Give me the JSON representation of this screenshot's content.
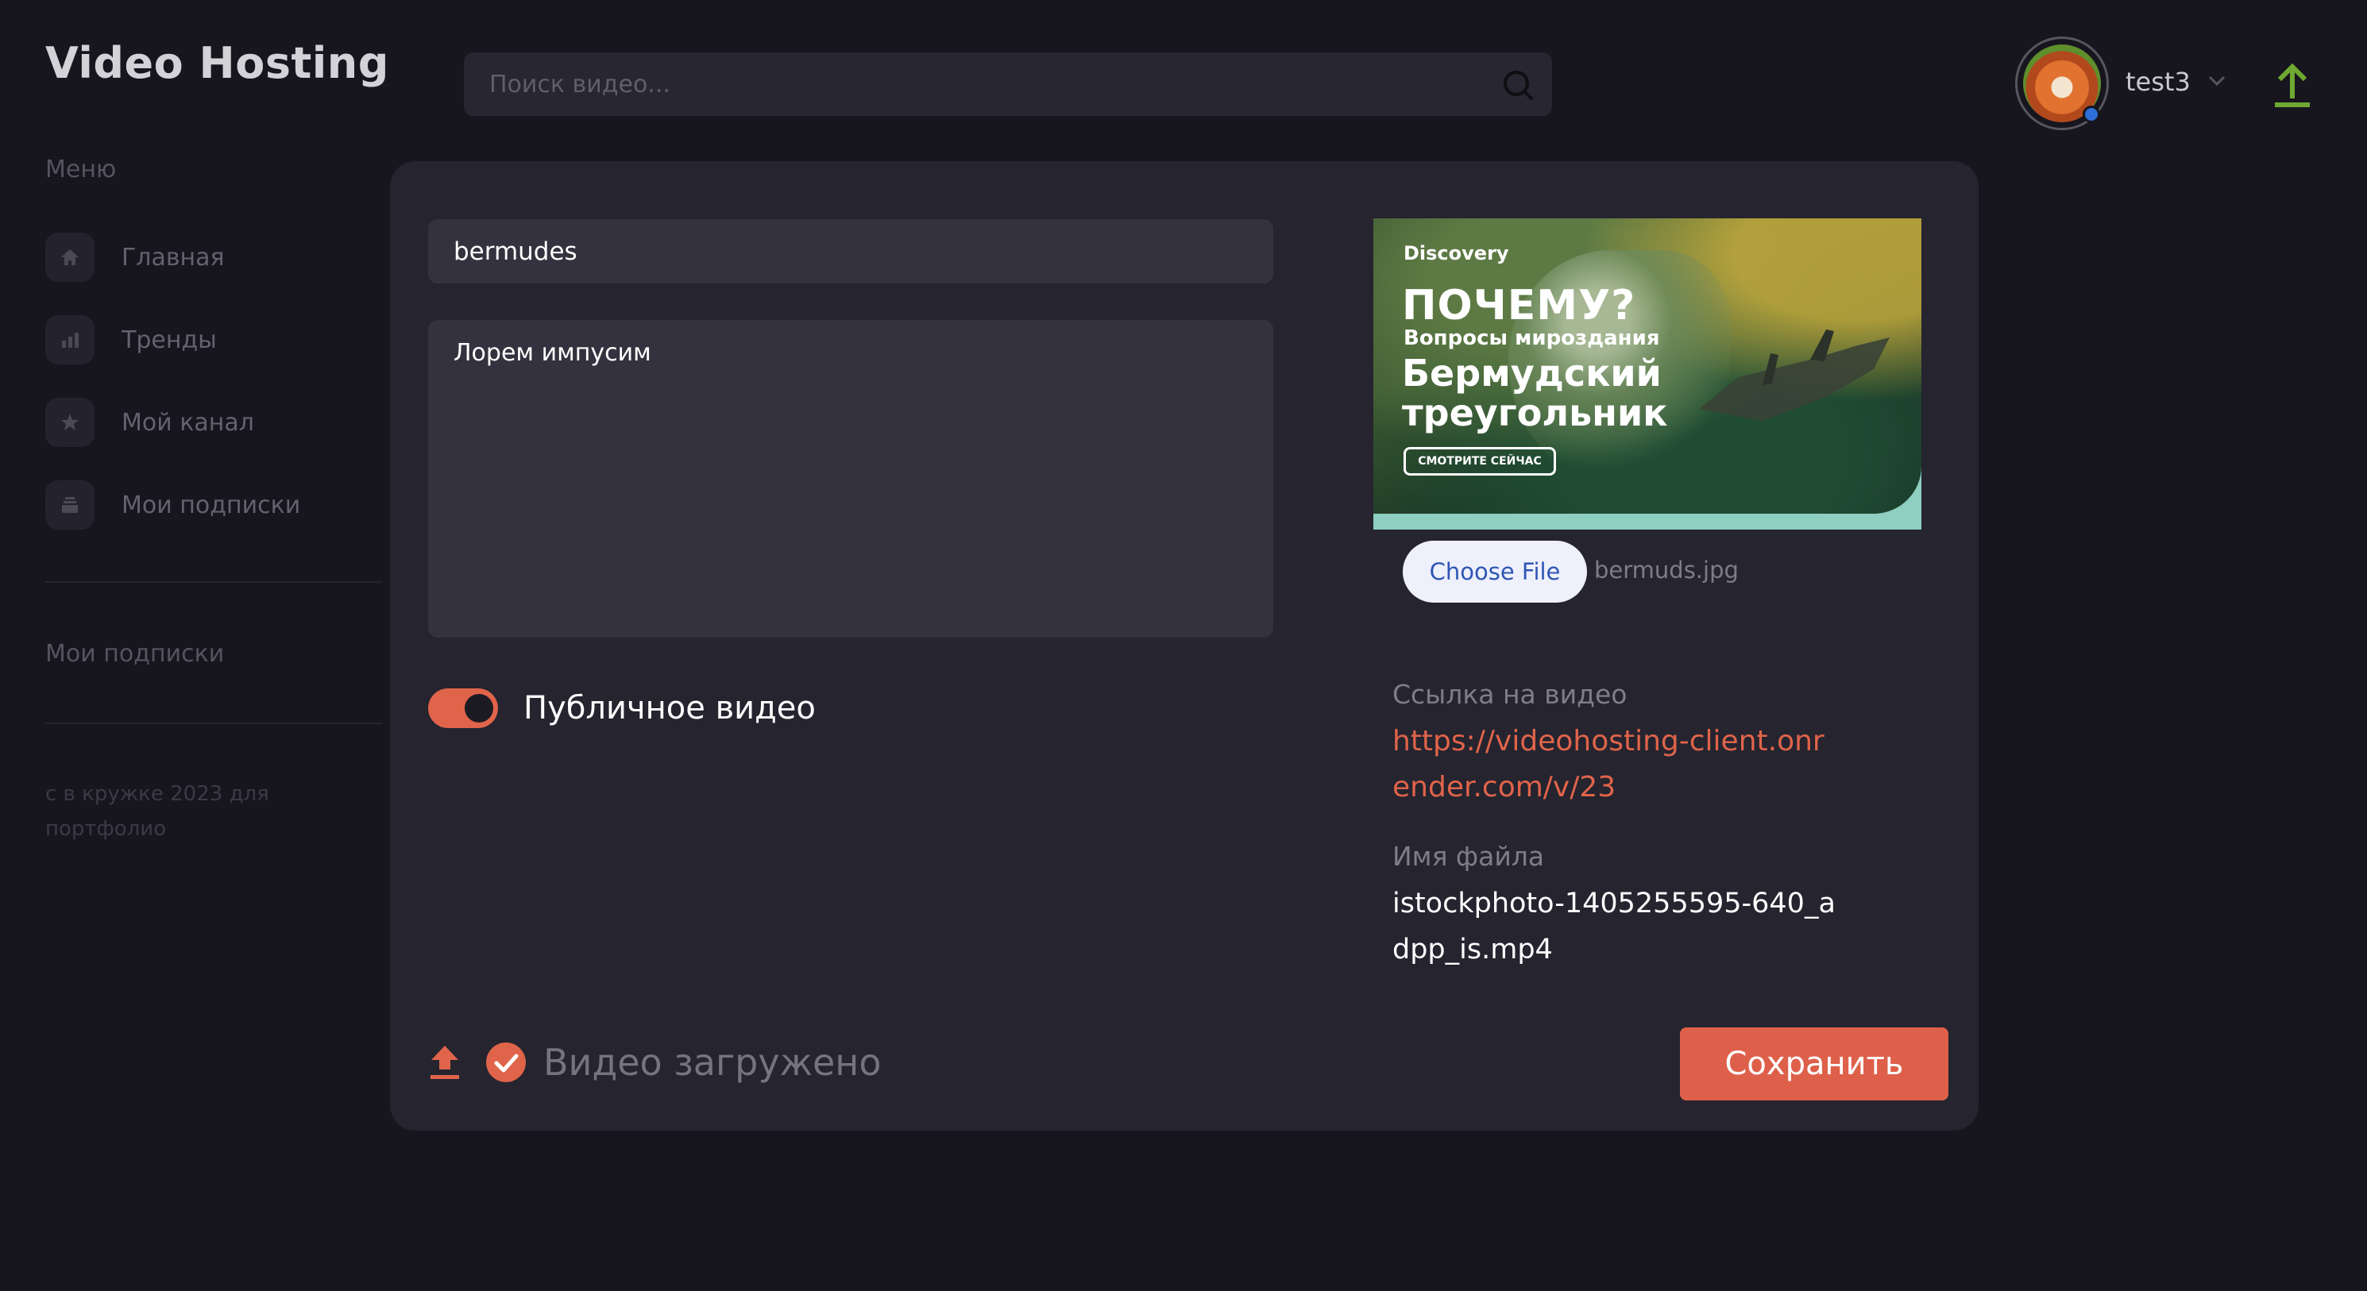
{
  "app": {
    "title": "Video Hosting"
  },
  "search": {
    "placeholder": "Поиск видео..."
  },
  "user": {
    "name": "test3"
  },
  "sidebar": {
    "menu_title": "Меню",
    "items": [
      {
        "label": "Главная",
        "icon": "home-icon"
      },
      {
        "label": "Тренды",
        "icon": "chart-icon"
      },
      {
        "label": "Мой канал",
        "icon": "star-icon"
      },
      {
        "label": "Мои подписки",
        "icon": "subscriptions-icon"
      }
    ],
    "subscriptions_title": "Мои подписки",
    "footer": "с в кружке 2023 для портфолио"
  },
  "editor": {
    "title_value": "bermudes",
    "description_value": "Лорем импусим",
    "public_label": "Публичное видео",
    "public_enabled": true,
    "thumbnail": {
      "brand": "Discovery",
      "headline": "ПОЧЕМУ?",
      "subheadline": "Вопросы мироздания",
      "title": "Бермудский треугольник",
      "cta": "СМОТРИТЕ СЕЙЧАС"
    },
    "choose_file_label": "Choose File",
    "chosen_file": "bermuds.jpg",
    "link_label": "Ссылка на видео",
    "link_value": "https://videohosting-client.onrender.com/v/23",
    "filename_label": "Имя файла",
    "filename_value": "istockphoto-1405255595-640_adpp_is.mp4",
    "status_text": "Видео загружено",
    "save_label": "Сохранить"
  },
  "colors": {
    "background": "#17161f",
    "card": "#25242f",
    "input": "#33323e",
    "accent": "#e0644a",
    "upload_green": "#6fa832"
  }
}
